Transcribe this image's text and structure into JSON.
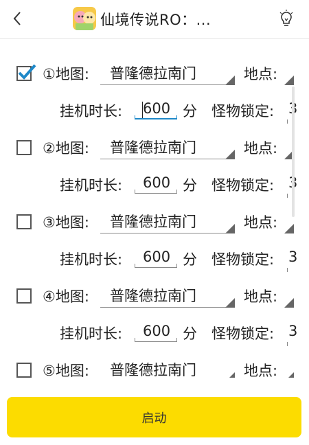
{
  "header": {
    "title": "仙境传说RO：...",
    "back_icon": "chevron-left-icon",
    "bulb_icon": "lightbulb-icon"
  },
  "rows": [
    {
      "number_label": "①地图:",
      "map_value": "普隆德拉南门",
      "place_label": "地点:",
      "duration_label": "挂机时长:",
      "duration_value": "600",
      "unit": "分",
      "lock_label": "怪物锁定:",
      "lock_value": "3",
      "checked": true
    },
    {
      "number_label": "②地图:",
      "map_value": "普隆德拉南门",
      "place_label": "地点:",
      "duration_label": "挂机时长:",
      "duration_value": "600",
      "unit": "分",
      "lock_label": "怪物锁定:",
      "lock_value": "3",
      "checked": false
    },
    {
      "number_label": "③地图:",
      "map_value": "普隆德拉南门",
      "place_label": "地点:",
      "duration_label": "挂机时长:",
      "duration_value": "600",
      "unit": "分",
      "lock_label": "怪物锁定:",
      "lock_value": "3",
      "checked": false
    },
    {
      "number_label": "④地图:",
      "map_value": "普隆德拉南门",
      "place_label": "地点:",
      "duration_label": "挂机时长:",
      "duration_value": "600",
      "unit": "分",
      "lock_label": "怪物锁定:",
      "lock_value": "3",
      "checked": false
    },
    {
      "number_label": "⑤地图:",
      "map_value": "普隆德拉南门",
      "place_label": "地点:",
      "checked": false
    }
  ],
  "start_button": {
    "label": "启动"
  },
  "colors": {
    "accent_yellow": "#fcdc00",
    "check_blue": "#1e88c8"
  }
}
